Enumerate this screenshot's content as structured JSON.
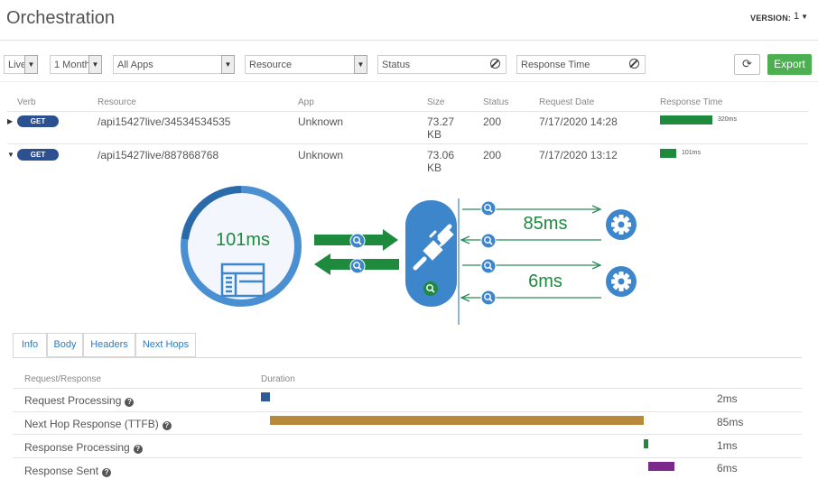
{
  "header": {
    "title": "Orchestration",
    "version_label": "VERSION:",
    "version_value": "1"
  },
  "filters": {
    "live": "Live",
    "period": "1 Month",
    "apps": "All Apps",
    "resource_placeholder": "Resource",
    "status_placeholder": "Status",
    "response_time_placeholder": "Response Time",
    "export_label": "Export"
  },
  "table": {
    "columns": [
      "Verb",
      "Resource",
      "App",
      "Size",
      "Status",
      "Request Date",
      "Response Time"
    ],
    "rows": [
      {
        "verb": "GET",
        "resource": "/api15427live/34534534535",
        "app": "Unknown",
        "size_value": "73.27",
        "size_unit": "KB",
        "status": "200",
        "date": "7/17/2020 14:28",
        "response_time": "320ms",
        "response_ms": 320,
        "expanded": false
      },
      {
        "verb": "GET",
        "resource": "/api15427live/887868768",
        "app": "Unknown",
        "size_value": "73.06",
        "size_unit": "KB",
        "status": "200",
        "date": "7/17/2020 13:12",
        "response_time": "101ms",
        "response_ms": 101,
        "expanded": true
      }
    ]
  },
  "diagram": {
    "total": "101ms",
    "hops": [
      {
        "duration": "85ms"
      },
      {
        "duration": "6ms"
      }
    ],
    "colors": {
      "ring": "#4a8fd2",
      "ring_dark": "#2a6aa8",
      "arrow": "#1e8a3e",
      "hop_arrow": "#2e8b57",
      "node": "#3d86cc"
    }
  },
  "tabs": [
    "Info",
    "Body",
    "Headers",
    "Next Hops"
  ],
  "details": {
    "col_request": "Request/Response",
    "col_duration": "Duration",
    "rows": [
      {
        "label": "Request Processing",
        "value": "2ms",
        "start": 0,
        "ms": 2,
        "color": "#2d5b9a"
      },
      {
        "label": "Next Hop Response (TTFB)",
        "value": "85ms",
        "start": 2,
        "ms": 85,
        "color": "#b8893a"
      },
      {
        "label": "Response Processing",
        "value": "1ms",
        "start": 87,
        "ms": 1,
        "color": "#1e8a3e"
      },
      {
        "label": "Response Sent",
        "value": "6ms",
        "start": 88,
        "ms": 6,
        "color": "#7b2a8c"
      }
    ]
  }
}
